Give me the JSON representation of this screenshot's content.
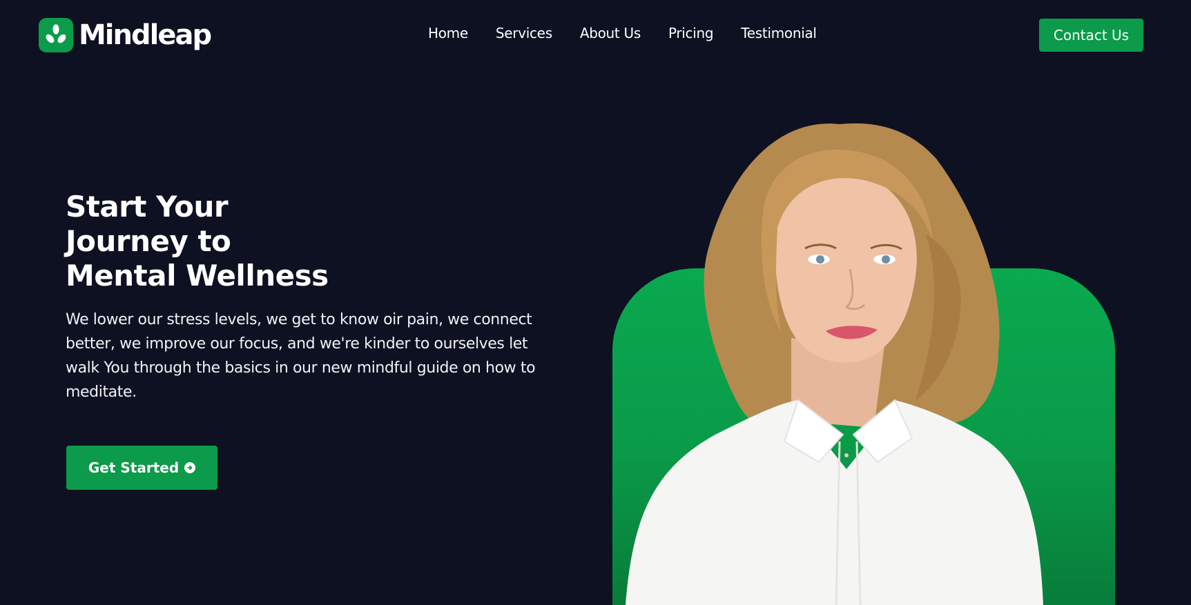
{
  "brand": {
    "name": "Mindleap",
    "accent_color": "#0b9b4a",
    "background_color": "#0e1122",
    "logo_icon": "sprout-leaves-icon"
  },
  "nav": {
    "items": [
      {
        "label": "Home"
      },
      {
        "label": "Services"
      },
      {
        "label": "About Us"
      },
      {
        "label": "Pricing"
      },
      {
        "label": "Testimonial"
      }
    ],
    "contact_label": "Contact Us"
  },
  "hero": {
    "title_lines": [
      "Start Your",
      "Journey to",
      "Mental Wellness"
    ],
    "description": "We lower our stress levels, we get to know oir pain, we connect better, we improve our focus, and we're kinder to ourselves let walk You through the basics in our new mindful guide on how to meditate.",
    "cta_label": "Get Started",
    "cta_icon": "arrow-right-circle-icon"
  }
}
